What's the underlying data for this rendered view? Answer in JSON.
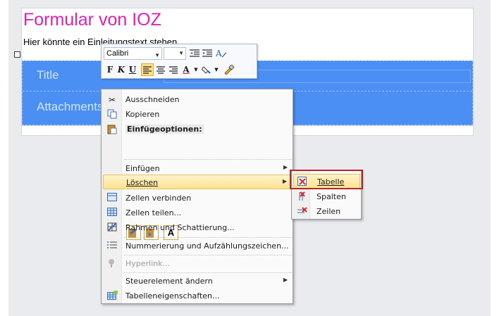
{
  "document": {
    "title": "Formular von IOZ",
    "intro": "Hier könnte ein Einleitungstext stehen",
    "rows": [
      {
        "label": "Title"
      },
      {
        "label": "Attachments"
      }
    ]
  },
  "mini_toolbar": {
    "font": "Calibri",
    "size": "",
    "bold": "F",
    "italic": "K",
    "underline": "U",
    "font_color_glyph": "A"
  },
  "context_menu": {
    "items": [
      {
        "label": "Ausschneiden",
        "icon": "scissors-icon"
      },
      {
        "label": "Kopieren",
        "icon": "copy-icon"
      },
      {
        "label": "Einfügeoptionen:",
        "icon": "paste-icon"
      },
      {
        "label": "Einfügen",
        "icon": ""
      },
      {
        "label": "Löschen",
        "icon": ""
      },
      {
        "label": "Zellen verbinden",
        "icon": "merge-cells-icon"
      },
      {
        "label": "Zellen teilen...",
        "icon": "split-cells-icon"
      },
      {
        "label": "Rahmen und Schattierung...",
        "icon": "borders-icon"
      },
      {
        "label": "Nummerierung und Aufzählungszeichen...",
        "icon": "numbering-icon"
      },
      {
        "label": "Hyperlink...",
        "icon": "hyperlink-icon"
      },
      {
        "label": "Steuerelement ändern",
        "icon": ""
      },
      {
        "label": "Tabelleneigenschaften...",
        "icon": "table-properties-icon"
      }
    ],
    "paste_options": [
      "keep-formatting",
      "merge-formatting",
      "A"
    ]
  },
  "delete_submenu": {
    "items": [
      {
        "label": "Tabelle",
        "icon": "delete-table-icon"
      },
      {
        "label": "Spalten",
        "icon": "delete-columns-icon"
      },
      {
        "label": "Zeilen",
        "icon": "delete-rows-icon"
      }
    ]
  },
  "colors": {
    "title_pink": "#e020b4",
    "table_blue": "#4b8ff5",
    "highlight_yellow": "#fde290",
    "annotation_red": "#b7262a"
  }
}
